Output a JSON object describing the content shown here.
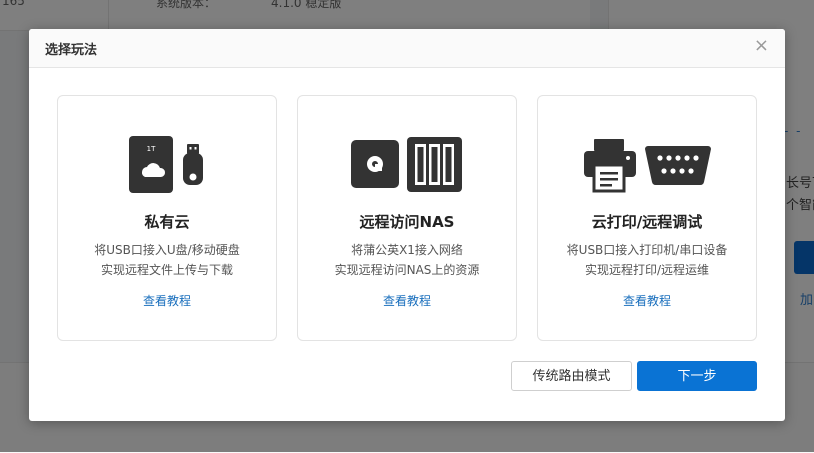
{
  "background": {
    "top_left_text": "165",
    "top_mid_label": "系统版本：",
    "top_mid_value": "4.1.0 稳定版",
    "right_text_1": "长号下",
    "right_text_2": "个智能",
    "right_link": "加"
  },
  "dialog": {
    "title": "选择玩法",
    "close_glyph": "×",
    "cards": [
      {
        "title": "私有云",
        "desc_line1": "将USB口接入U盘/移动硬盘",
        "desc_line2": "实现远程文件上传与下载",
        "link": "查看教程",
        "icon_text": "1T"
      },
      {
        "title": "远程访问NAS",
        "desc_line1": "将蒲公英X1接入网络",
        "desc_line2": "实现远程访问NAS上的资源",
        "link": "查看教程"
      },
      {
        "title": "云打印/远程调试",
        "desc_line1": "将USB口接入打印机/串口设备",
        "desc_line2": "实现远程打印/远程运维",
        "link": "查看教程"
      }
    ],
    "buttons": {
      "secondary": "传统路由模式",
      "primary": "下一步"
    }
  },
  "colors": {
    "primary": "#0a73d4",
    "link": "#1a6fbd",
    "icon": "#333333"
  }
}
